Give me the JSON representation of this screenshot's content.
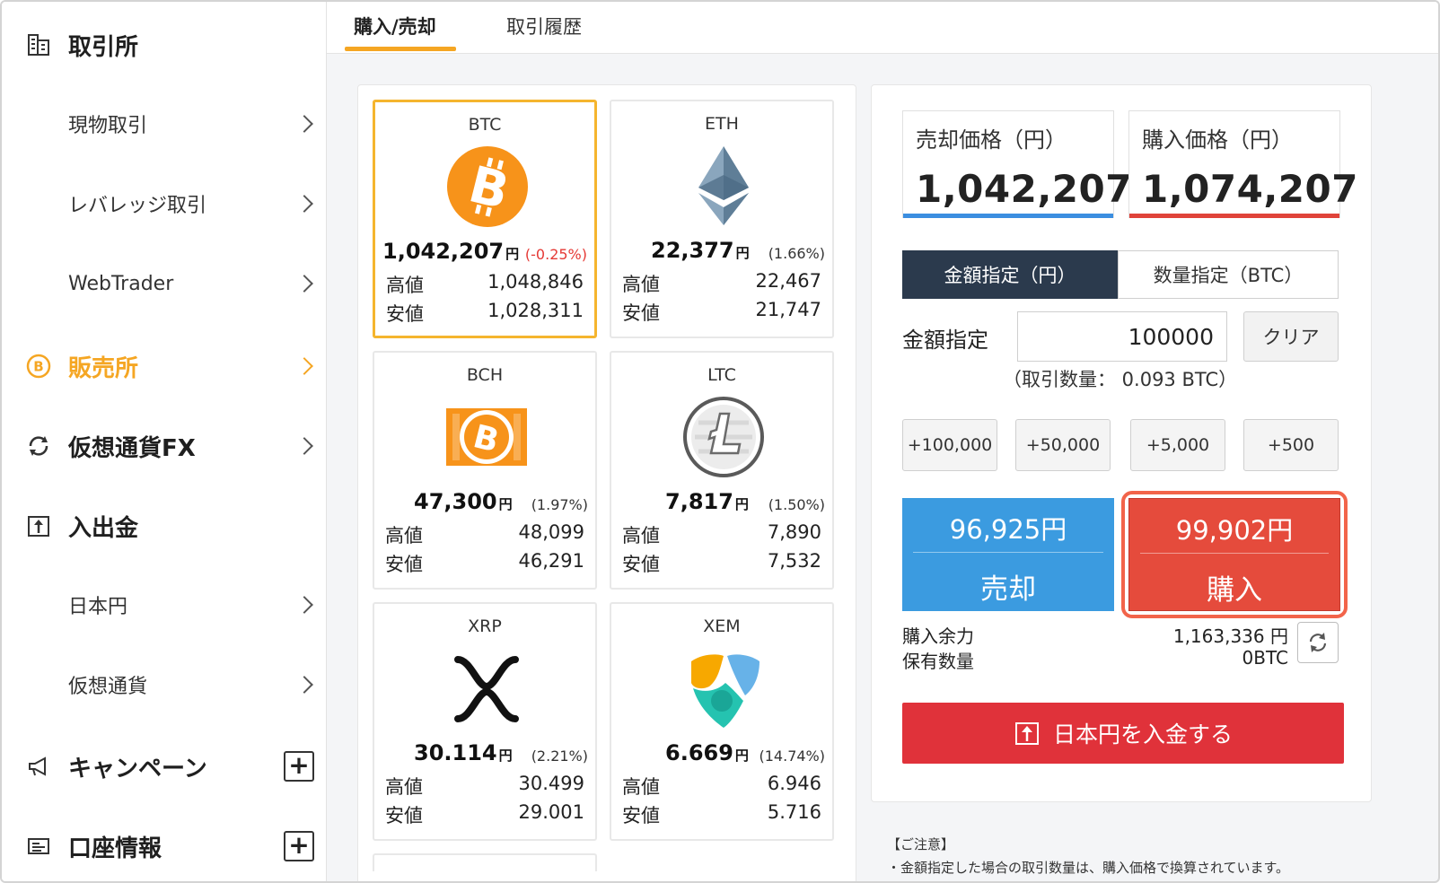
{
  "sidebar": {
    "items": [
      {
        "label": "取引所",
        "type": "main",
        "icon": "exchange-building-icon"
      },
      {
        "label": "現物取引",
        "type": "sub"
      },
      {
        "label": "レバレッジ取引",
        "type": "sub"
      },
      {
        "label": "WebTrader",
        "type": "sub"
      },
      {
        "label": "販売所",
        "type": "main",
        "icon": "bitcoin-coin-icon",
        "active": true
      },
      {
        "label": "仮想通貨FX",
        "type": "main",
        "icon": "swap-arrows-icon"
      },
      {
        "label": "入出金",
        "type": "main",
        "icon": "deposit-upload-icon"
      },
      {
        "label": "日本円",
        "type": "sub"
      },
      {
        "label": "仮想通貨",
        "type": "sub"
      },
      {
        "label": "キャンペーン",
        "type": "main",
        "icon": "megaphone-icon",
        "expand": "+"
      },
      {
        "label": "口座情報",
        "type": "main",
        "icon": "id-card-icon",
        "expand": "+"
      }
    ]
  },
  "tabs": {
    "buy_sell": "購入/売却",
    "history": "取引履歴"
  },
  "coins": [
    {
      "symbol": "BTC",
      "price": "1,042,207",
      "yen": "円",
      "change": "(-0.25%)",
      "high_label": "高値",
      "high": "1,048,846",
      "low_label": "安値",
      "low": "1,028,311"
    },
    {
      "symbol": "ETH",
      "price": "22,377",
      "yen": "円",
      "change": "(1.66%)",
      "high_label": "高値",
      "high": "22,467",
      "low_label": "安値",
      "low": "21,747"
    },
    {
      "symbol": "BCH",
      "price": "47,300",
      "yen": "円",
      "change": "(1.97%)",
      "high_label": "高値",
      "high": "48,099",
      "low_label": "安値",
      "low": "46,291"
    },
    {
      "symbol": "LTC",
      "price": "7,817",
      "yen": "円",
      "change": "(1.50%)",
      "high_label": "高値",
      "high": "7,890",
      "low_label": "安値",
      "low": "7,532"
    },
    {
      "symbol": "XRP",
      "price": "30.114",
      "yen": "円",
      "change": "(2.21%)",
      "high_label": "高値",
      "high": "30.499",
      "low_label": "安値",
      "low": "29.001"
    },
    {
      "symbol": "XEM",
      "price": "6.669",
      "yen": "円",
      "change": "(14.74%)",
      "high_label": "高値",
      "high": "6.946",
      "low_label": "安値",
      "low": "5.716"
    }
  ],
  "trade": {
    "sell_price_label": "売却価格（円）",
    "sell_price": "1,042,207",
    "buy_price_label": "購入価格（円）",
    "buy_price": "1,074,207",
    "mode_amount": "金額指定（円）",
    "mode_quantity": "数量指定（BTC）",
    "amount_label": "金額指定",
    "amount_value": "100000",
    "clear": "クリア",
    "qty_note": "（取引数量： 0.093 BTC）",
    "quick": [
      "+100,000",
      "+50,000",
      "+5,000",
      "+500"
    ],
    "sell_amount": "96,925円",
    "sell_action": "売却",
    "buy_amount": "99,902円",
    "buy_action": "購入",
    "available_label": "購入余力",
    "available_value": "1,163,336 円",
    "holding_label": "保有数量",
    "holding_value": "0BTC",
    "deposit": "日本円を入金する"
  },
  "notice": {
    "head": "【ご注意】",
    "body": "・金額指定した場合の取引数量は、購入価格で換算されています。"
  },
  "colors": {
    "accent_orange": "#f5a623",
    "sell_blue": "#3b9be0",
    "buy_red": "#e54b3c",
    "deposit_red": "#e0323a",
    "segment_dark": "#2b3a4d"
  }
}
